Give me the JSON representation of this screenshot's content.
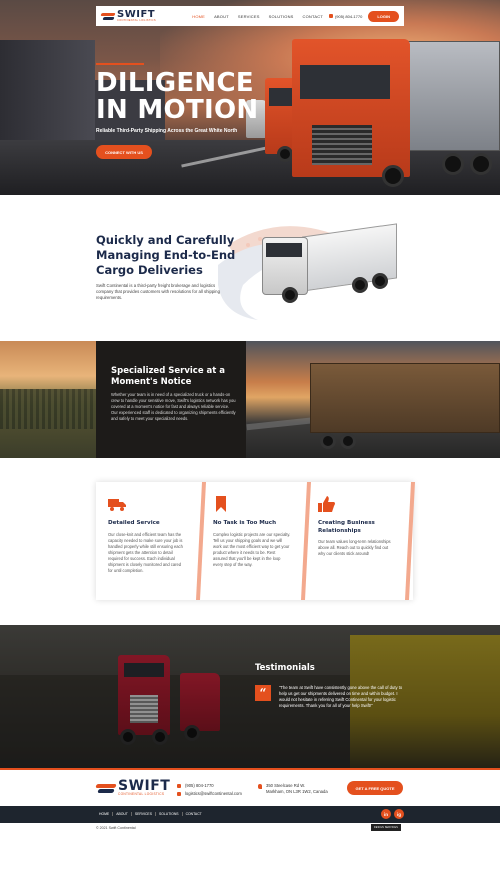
{
  "brand": {
    "name": "SWIFT",
    "subtitle": "CONTINENTAL LOGISTICS"
  },
  "nav": {
    "links": [
      "HOME",
      "ABOUT",
      "SERVICES",
      "SOLUTIONS",
      "CONTACT"
    ],
    "active": "HOME",
    "phone": "(905) 804-1770",
    "login_label": "LOGIN"
  },
  "hero": {
    "title": "DILIGENCE\nIN MOTION",
    "tagline": "Reliable Third-Party Shipping Across the Great White North",
    "cta_label": "CONNECT WITH US"
  },
  "about": {
    "heading": "Quickly and Carefully Managing End-to-End Cargo Deliveries",
    "body": "Swift Continental is a third-party freight brokerage and logistics company that provides customers with resolutions for all shipping requirements."
  },
  "specialized": {
    "heading": "Specialized Service at a Moment's Notice",
    "body": "Whether your team is in need of a specialized truck or a hands-on crew to handle your sensitive move, Swift's logistics network has you covered at a moment's notice for fast and always reliable service. Our experienced staff is dedicated to organizing shipments efficiently and safely to meet your specialized needs."
  },
  "services": [
    {
      "icon": "truck-icon",
      "title": "Detailed Service",
      "body": "Our close-knit and efficient team has the capacity needed to make sure your job is handled properly while still ensuring each shipment gets the attention to detail required for success. Each individual shipment is closely monitored and cared for until completion."
    },
    {
      "icon": "bookmark-icon",
      "title": "No Task is Too Much",
      "body": "Complex logistic projects are our specialty. Tell us your shipping goals and we will work out the most efficient way to get your product where it needs to be. Rest assured that you'll be kept in the loop every step of the way."
    },
    {
      "icon": "thumbs-up-icon",
      "title": "Creating Business Relationships",
      "body": "Our team values long-term relationships above all. Reach out to quickly find out why our clients stick around!"
    }
  ],
  "testimonials": {
    "heading": "Testimonials",
    "quote": "\"The team at Swift have consistently gone above the call of duty to help us get our shipments delivered on time and within budget. I would not hesitate in referring Swift Continental for your logistic requirements. Thank you for all of your help Swift!\""
  },
  "footer": {
    "phone": "(905) 804-1770",
    "email": "logistics@swiftcontinental.com",
    "address_line1": "350 Steelcase Rd W.",
    "address_line2": "Markham, ON L3R 1W2, Canada",
    "quote_label": "GET A FREE QUOTE",
    "nav_links": [
      "HOME",
      "ABOUT",
      "SERVICES",
      "SOLUTIONS",
      "CONTACT"
    ],
    "social": [
      "in",
      "ig"
    ],
    "copyright": "© 2021 Swift Continental",
    "badge": "DESIGN SERVICES"
  },
  "colors": {
    "accent": "#e4501e",
    "navy": "#1c2a4a",
    "footer_dark": "#1e252e"
  }
}
